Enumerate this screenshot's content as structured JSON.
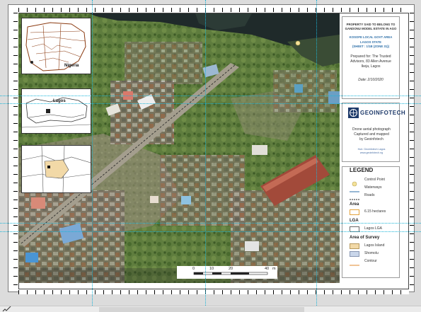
{
  "title_block": {
    "project": [
      "PROPERTY SAID TO BELONG TO",
      "GANDONU MODEL ESTATE IN AGO"
    ],
    "lga": [
      "KOSOFE LOCAL GOVT AREA",
      "LAGOS STATE",
      "(SHEET : 1/1B (ZONE 31))"
    ],
    "prepared": [
      "Prepared for: The Trusted",
      "Advisors, 83 Allen Avenue",
      "Ikeja, Lagos"
    ],
    "date": "Date: 2/10/2020"
  },
  "company": {
    "name": "GEOINFOTECH",
    "description": [
      "Drone aerial photograph",
      "Captured and mapped",
      "by Geoinfotech"
    ],
    "small_text": [
      "Hub: Geoinfotech Lagos",
      "www.geoinfotech.ng"
    ]
  },
  "insets": {
    "nigeria_label": "Nigeria",
    "lagos_label": "Lagos"
  },
  "legend": {
    "title": "LEGEND",
    "items": [
      {
        "label": "Control Point"
      },
      {
        "label": "Waterways"
      },
      {
        "label": "Roads"
      }
    ],
    "area_header": "Area",
    "area_items": [
      {
        "label": "6.15 hectares"
      }
    ],
    "lga_header": "LGA",
    "lga_items": [
      {
        "label": "Lagos LGA"
      }
    ],
    "survey_header": "Area of  Survey",
    "survey_items": [
      {
        "label": "Lagos Island"
      },
      {
        "label": "Shomolu"
      },
      {
        "label": "Contour"
      }
    ]
  },
  "scalebar": {
    "ticks": [
      "0",
      "10",
      "20",
      "40"
    ],
    "unit": "m"
  },
  "colors": {
    "vegetation": "#5d7a3d",
    "water": "#1f2a2a",
    "waterway": "#2d6fa8",
    "area_fill": "#f2d9a7",
    "guide": "#19b5d8"
  }
}
